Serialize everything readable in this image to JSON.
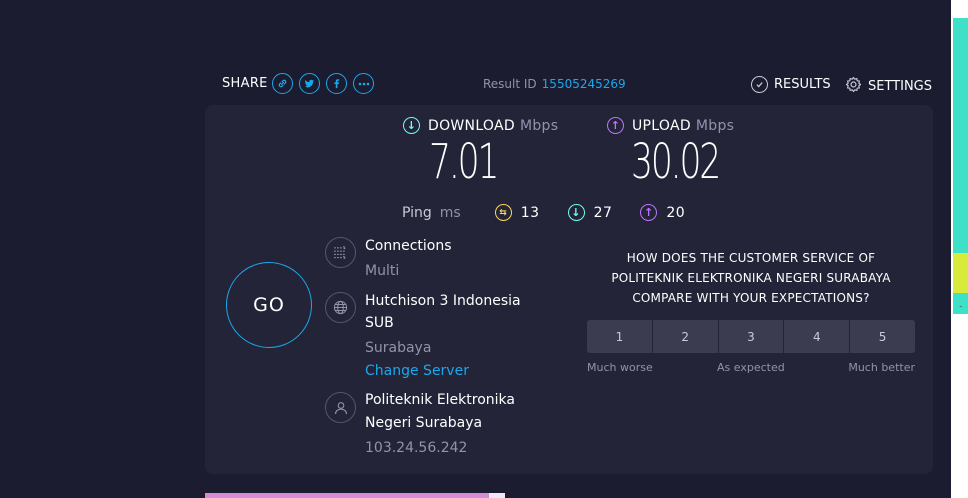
{
  "topbar": {
    "share_label": "SHARE",
    "share_icons": [
      "link-icon",
      "twitter-icon",
      "facebook-icon",
      "more-icon"
    ],
    "result_id_label": "Result ID",
    "result_id": "15505245269",
    "results_label": "RESULTS",
    "settings_label": "SETTINGS"
  },
  "download": {
    "label": "DOWNLOAD",
    "unit": "Mbps",
    "value": "7.01"
  },
  "upload": {
    "label": "UPLOAD",
    "unit": "Mbps",
    "value": "30.02"
  },
  "ping": {
    "label": "Ping",
    "unit": "ms",
    "idle": "13",
    "download": "27",
    "upload": "20"
  },
  "go_label": "GO",
  "connections": {
    "label": "Connections",
    "value": "Multi"
  },
  "server": {
    "name_line1": "Hutchison 3 Indonesia",
    "name_line2": "SUB",
    "location": "Surabaya",
    "change_label": "Change Server"
  },
  "provider": {
    "name_line1": "Politeknik Elektronika",
    "name_line2": "Negeri Surabaya",
    "ip": "103.24.56.242"
  },
  "survey": {
    "line1": "HOW DOES THE CUSTOMER SERVICE OF",
    "line2": "POLITEKNIK ELEKTRONIKA NEGERI SURABAYA",
    "line3": "COMPARE WITH YOUR EXPECTATIONS?",
    "options": [
      "1",
      "2",
      "3",
      "4",
      "5"
    ],
    "low_label": "Much worse",
    "mid_label": "As expected",
    "high_label": "Much better"
  },
  "colors": {
    "background": "#1b1c2f",
    "panel": "#232437",
    "accent": "#1ca7ec",
    "download": "#6afff3",
    "upload": "#bf71ff",
    "ping": "#fbd65b"
  }
}
